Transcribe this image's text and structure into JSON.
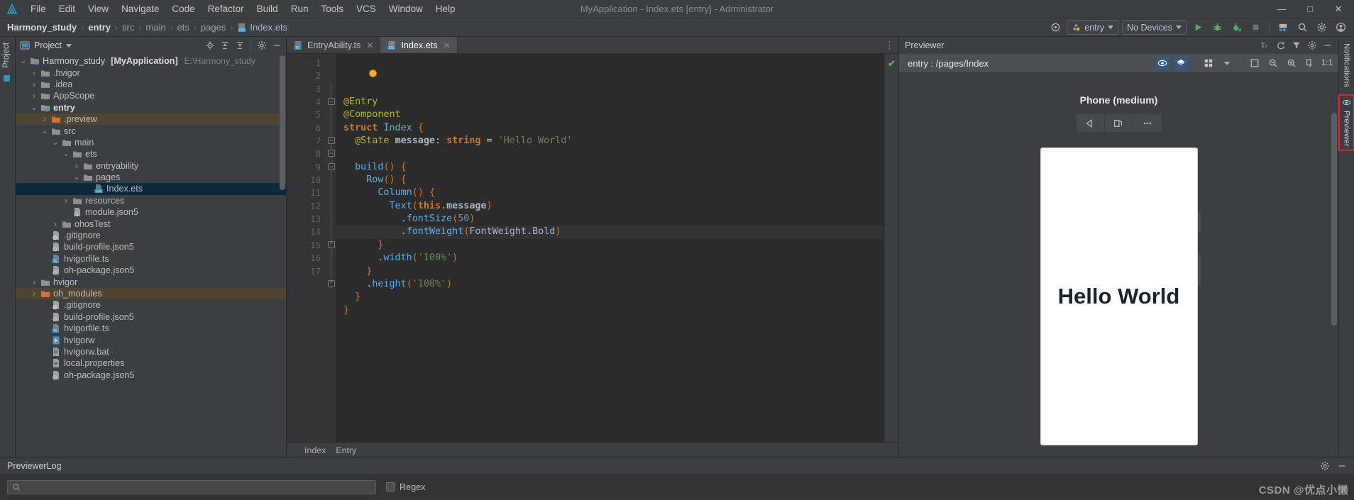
{
  "window": {
    "title": "MyApplication - Index.ets [entry] - Administrator",
    "minimize": "—",
    "maximize": "□",
    "close": "✕"
  },
  "menu": {
    "items": [
      "File",
      "Edit",
      "View",
      "Navigate",
      "Code",
      "Refactor",
      "Build",
      "Run",
      "Tools",
      "VCS",
      "Window",
      "Help"
    ]
  },
  "breadcrumb": {
    "items": [
      "Harmony_study",
      "entry",
      "src",
      "main",
      "ets",
      "pages",
      "Index.ets"
    ],
    "separator": "›"
  },
  "toolbar": {
    "target_icon": "target-icon",
    "run_config": "entry",
    "devices": "No Devices",
    "run": "run-icon",
    "debug": "debug-icon",
    "profile": "profile-icon",
    "stop": "stop-icon",
    "device_manager": "device-manager-icon",
    "search": "search-icon",
    "settings": "gear-icon",
    "account": "account-icon"
  },
  "left_strip": {
    "label": "Project"
  },
  "project": {
    "title": "Project",
    "tools": [
      "locate-icon",
      "expand-all-icon",
      "collapse-all-icon",
      "gear-icon",
      "hide-icon"
    ],
    "tree": [
      {
        "label": "Harmony_study",
        "bold_suffix": "[MyApplication]",
        "path": "E:\\Harmony_study",
        "indent": 0,
        "arrow": "open",
        "icon": "module-folder",
        "state": "normal"
      },
      {
        "label": ".hvigor",
        "indent": 1,
        "arrow": "closed",
        "icon": "folder",
        "state": "normal"
      },
      {
        "label": ".idea",
        "indent": 1,
        "arrow": "closed",
        "icon": "folder",
        "state": "normal"
      },
      {
        "label": "AppScope",
        "indent": 1,
        "arrow": "closed",
        "icon": "folder",
        "state": "normal"
      },
      {
        "label": "entry",
        "indent": 1,
        "arrow": "open",
        "icon": "module-folder",
        "state": "bold"
      },
      {
        "label": ".preview",
        "indent": 2,
        "arrow": "closed",
        "icon": "folder-orange",
        "state": "highlight"
      },
      {
        "label": "src",
        "indent": 2,
        "arrow": "open",
        "icon": "folder",
        "state": "normal"
      },
      {
        "label": "main",
        "indent": 3,
        "arrow": "open",
        "icon": "folder",
        "state": "normal"
      },
      {
        "label": "ets",
        "indent": 4,
        "arrow": "open",
        "icon": "folder",
        "state": "normal"
      },
      {
        "label": "entryability",
        "indent": 5,
        "arrow": "closed",
        "icon": "folder",
        "state": "normal"
      },
      {
        "label": "pages",
        "indent": 5,
        "arrow": "open",
        "icon": "folder",
        "state": "normal"
      },
      {
        "label": "Index.ets",
        "indent": 6,
        "arrow": "none",
        "icon": "ets-file",
        "state": "selected"
      },
      {
        "label": "resources",
        "indent": 4,
        "arrow": "closed",
        "icon": "folder",
        "state": "normal"
      },
      {
        "label": "module.json5",
        "indent": 4,
        "arrow": "none",
        "icon": "json-file",
        "state": "normal"
      },
      {
        "label": "ohosTest",
        "indent": 3,
        "arrow": "closed",
        "icon": "folder",
        "state": "normal"
      },
      {
        "label": ".gitignore",
        "indent": 2,
        "arrow": "none",
        "icon": "gitignore-file",
        "state": "normal"
      },
      {
        "label": "build-profile.json5",
        "indent": 2,
        "arrow": "none",
        "icon": "json-file",
        "state": "normal"
      },
      {
        "label": "hvigorfile.ts",
        "indent": 2,
        "arrow": "none",
        "icon": "ts-file",
        "state": "normal"
      },
      {
        "label": "oh-package.json5",
        "indent": 2,
        "arrow": "none",
        "icon": "json-file",
        "state": "normal"
      },
      {
        "label": "hvigor",
        "indent": 1,
        "arrow": "closed",
        "icon": "folder",
        "state": "normal"
      },
      {
        "label": "oh_modules",
        "indent": 1,
        "arrow": "closed",
        "icon": "folder-orange",
        "state": "highlight"
      },
      {
        "label": ".gitignore",
        "indent": 2,
        "arrow": "none",
        "icon": "gitignore-file",
        "state": "normal"
      },
      {
        "label": "build-profile.json5",
        "indent": 2,
        "arrow": "none",
        "icon": "json-file",
        "state": "normal"
      },
      {
        "label": "hvigorfile.ts",
        "indent": 2,
        "arrow": "none",
        "icon": "ts-file",
        "state": "normal"
      },
      {
        "label": "hvigorw",
        "indent": 2,
        "arrow": "none",
        "icon": "exec-file",
        "state": "normal"
      },
      {
        "label": "hvigorw.bat",
        "indent": 2,
        "arrow": "none",
        "icon": "bat-file",
        "state": "normal"
      },
      {
        "label": "local.properties",
        "indent": 2,
        "arrow": "none",
        "icon": "prop-file",
        "state": "normal"
      },
      {
        "label": "oh-package.json5",
        "indent": 2,
        "arrow": "none",
        "icon": "json-file",
        "state": "normal"
      }
    ]
  },
  "editor": {
    "tabs": [
      {
        "label": "EntryAbility.ts",
        "icon": "ts-file",
        "active": false,
        "close": "✕"
      },
      {
        "label": "Index.ets",
        "icon": "ets-file",
        "active": true,
        "close": "✕"
      }
    ],
    "kebab": "⋮",
    "inspection_ok": "✔",
    "line_numbers": [
      1,
      2,
      3,
      4,
      5,
      6,
      7,
      8,
      9,
      10,
      11,
      12,
      13,
      14,
      15,
      16,
      17
    ],
    "code_lines": [
      "@Entry",
      "@Component",
      "struct Index {",
      "  @State message: string = 'Hello World'",
      "",
      "  build() {",
      "    Row() {",
      "      Column() {",
      "        Text(this.message)",
      "          .fontSize(50)",
      "          .fontWeight(FontWeight.Bold)",
      "      }",
      "      .width('100%')",
      "    }",
      "    .height('100%')",
      "  }",
      "}"
    ],
    "status_breadcrumb": [
      "Index",
      "Entry"
    ]
  },
  "previewer": {
    "title": "Previewer",
    "route": "entry : /pages/Index",
    "toolbar_top": [
      "settings-icon",
      "hide-icon"
    ],
    "sub_tools": [
      "inspector-icon",
      "layers-icon",
      "grid-icon",
      "chevron-down-icon",
      "fit-icon",
      "zoom-out-icon",
      "zoom-in-icon",
      "rotate-icon",
      "ratio-label"
    ],
    "ratio": "1:1",
    "device_label": "Phone (medium)",
    "device_controls": [
      "back-icon",
      "multitask-icon",
      "more-icon"
    ],
    "screen_text": "Hello World"
  },
  "right_strip": {
    "notifications": "Notifications",
    "previewer": "Previewer"
  },
  "bottom": {
    "title": "PreviewerLog",
    "tools": [
      "gear-icon",
      "hide-icon"
    ],
    "search_placeholder": "",
    "search_value": "",
    "search_icon": "search-icon",
    "regex_label": "Regex"
  },
  "watermark": "CSDN @优点小懒",
  "colors": {
    "accent": "#3592c4",
    "selection": "#0d293e",
    "highlight": "#4e4633",
    "orange_folder": "#cc7832",
    "green_ok": "#62b543",
    "red_box": "#ff1a1a"
  }
}
